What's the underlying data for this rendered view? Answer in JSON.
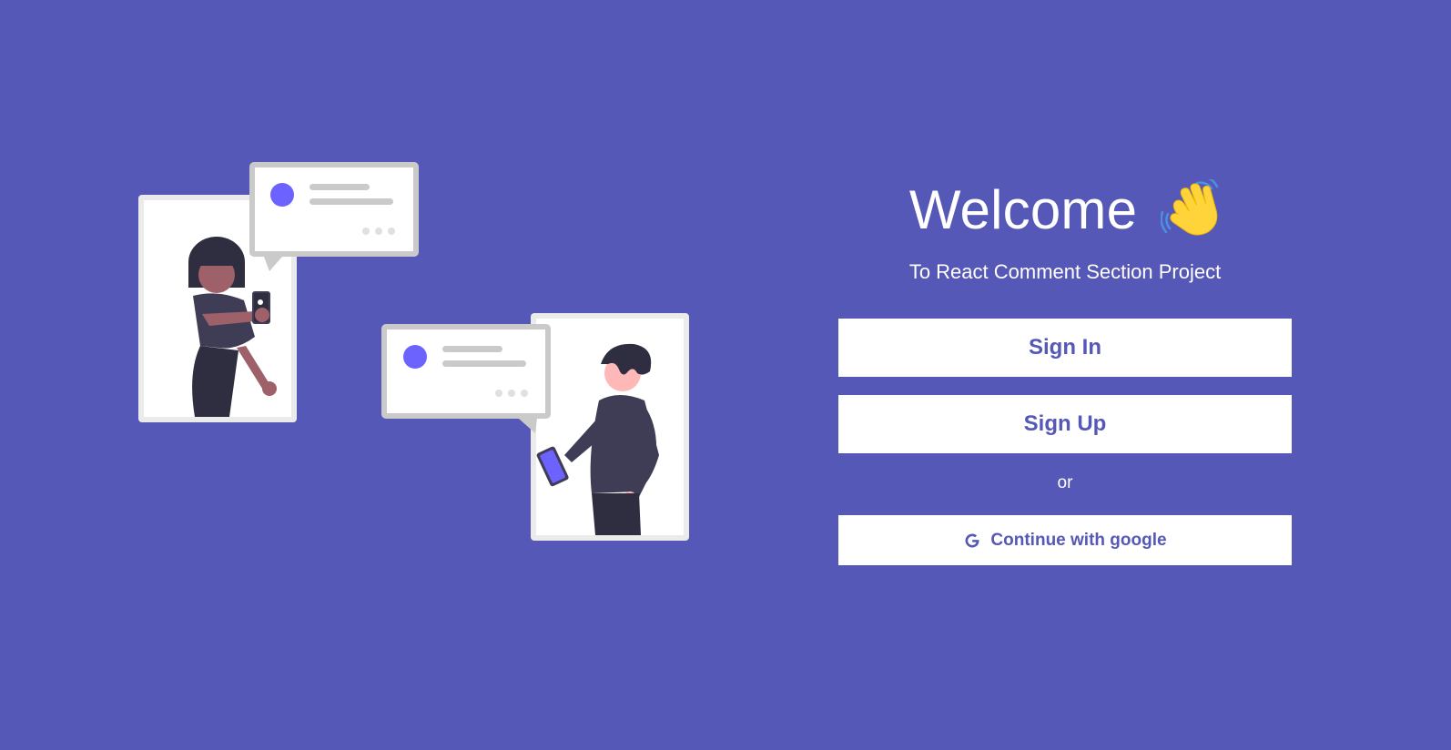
{
  "welcome": {
    "title": "Welcome",
    "wave_icon": "waving-hand-icon"
  },
  "subtitle": "To React Comment Section Project",
  "buttons": {
    "sign_in": "Sign In",
    "sign_up": "Sign Up",
    "or": "or",
    "google": "Continue with google",
    "google_icon": "google-g-icon"
  },
  "colors": {
    "background": "#5558b6",
    "button_bg": "#ffffff",
    "button_text": "#5558b6",
    "accent": "#6c63ff"
  }
}
